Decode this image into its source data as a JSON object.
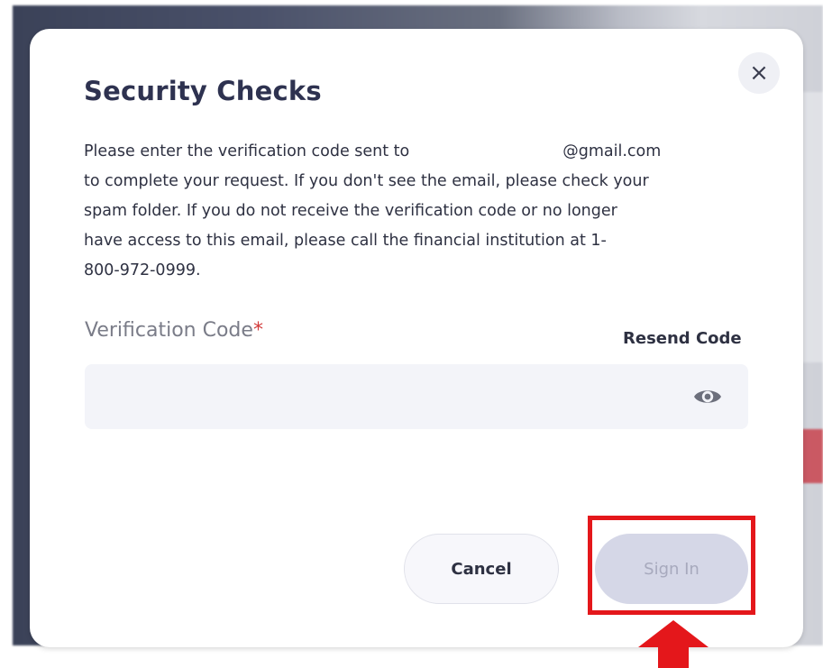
{
  "modal": {
    "title": "Security Checks",
    "close_glyph": "×",
    "description": {
      "line1_start": "Please enter the verification code sent to",
      "line1_end": "@gmail.com",
      "line2": "to complete your request. If you don't see the email, please check your",
      "line3": "spam folder. If you do not receive the verification code or no longer",
      "line4": "have access to this email, please call the financial institution at 1-",
      "line5": "800-972-0999."
    },
    "field": {
      "label": "Verification Code",
      "required_mark": "*",
      "value": "",
      "placeholder": "",
      "toggle_icon": "eye-icon"
    },
    "resend_label": "Resend Code",
    "cancel_label": "Cancel",
    "signin_label": "Sign In"
  },
  "annotation": {
    "color": "#e4171b",
    "target": "sign-in-button"
  },
  "colors": {
    "title": "#2e3250",
    "text": "#2e3142",
    "required": "#d23a3a",
    "input_bg": "#f3f4f9",
    "signin_disabled_bg": "#d5d7e7"
  }
}
